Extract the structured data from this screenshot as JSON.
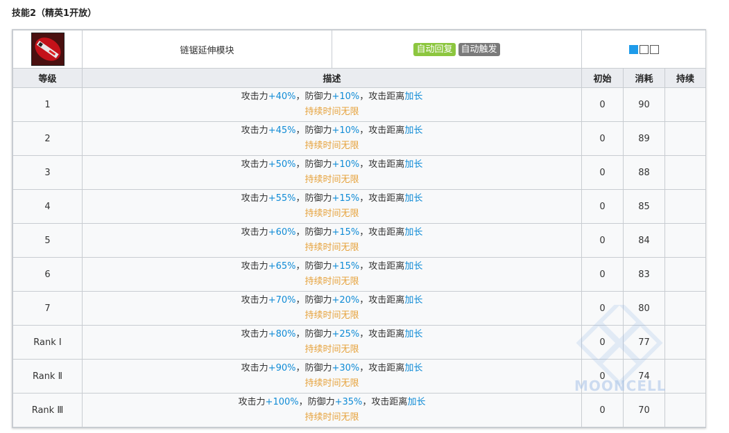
{
  "heading": "技能2（精英1开放）",
  "skill": {
    "name": "链锯延伸模块",
    "tags": [
      {
        "label": "自动回复",
        "color": "#8cc63f"
      },
      {
        "label": "自动触发",
        "color": "#7a7a7a"
      }
    ],
    "sp_indicator": {
      "filled": 1,
      "total": 3,
      "accent": "#1e9bea"
    }
  },
  "columns": {
    "level": "等级",
    "desc": "描述",
    "initial": "初始",
    "cost": "消耗",
    "duration": "持续"
  },
  "text_parts": {
    "atk": "攻击力",
    "sep1": "，防御力",
    "sep2": "，攻击距离",
    "range": "加长",
    "duration": "持续时间无限"
  },
  "rows": [
    {
      "level": "1",
      "atk": "+40%",
      "def": "+10%",
      "initial": "0",
      "cost": "90",
      "duration": ""
    },
    {
      "level": "2",
      "atk": "+45%",
      "def": "+10%",
      "initial": "0",
      "cost": "89",
      "duration": ""
    },
    {
      "level": "3",
      "atk": "+50%",
      "def": "+10%",
      "initial": "0",
      "cost": "88",
      "duration": ""
    },
    {
      "level": "4",
      "atk": "+55%",
      "def": "+15%",
      "initial": "0",
      "cost": "85",
      "duration": ""
    },
    {
      "level": "5",
      "atk": "+60%",
      "def": "+15%",
      "initial": "0",
      "cost": "84",
      "duration": ""
    },
    {
      "level": "6",
      "atk": "+65%",
      "def": "+15%",
      "initial": "0",
      "cost": "83",
      "duration": ""
    },
    {
      "level": "7",
      "atk": "+70%",
      "def": "+20%",
      "initial": "0",
      "cost": "80",
      "duration": ""
    },
    {
      "level": "Rank Ⅰ",
      "atk": "+80%",
      "def": "+25%",
      "initial": "0",
      "cost": "77",
      "duration": ""
    },
    {
      "level": "Rank Ⅱ",
      "atk": "+90%",
      "def": "+30%",
      "initial": "0",
      "cost": "74",
      "duration": ""
    },
    {
      "level": "Rank Ⅲ",
      "atk": "+100%",
      "def": "+35%",
      "initial": "0",
      "cost": "70",
      "duration": ""
    }
  ],
  "watermark": "MOONCELL"
}
